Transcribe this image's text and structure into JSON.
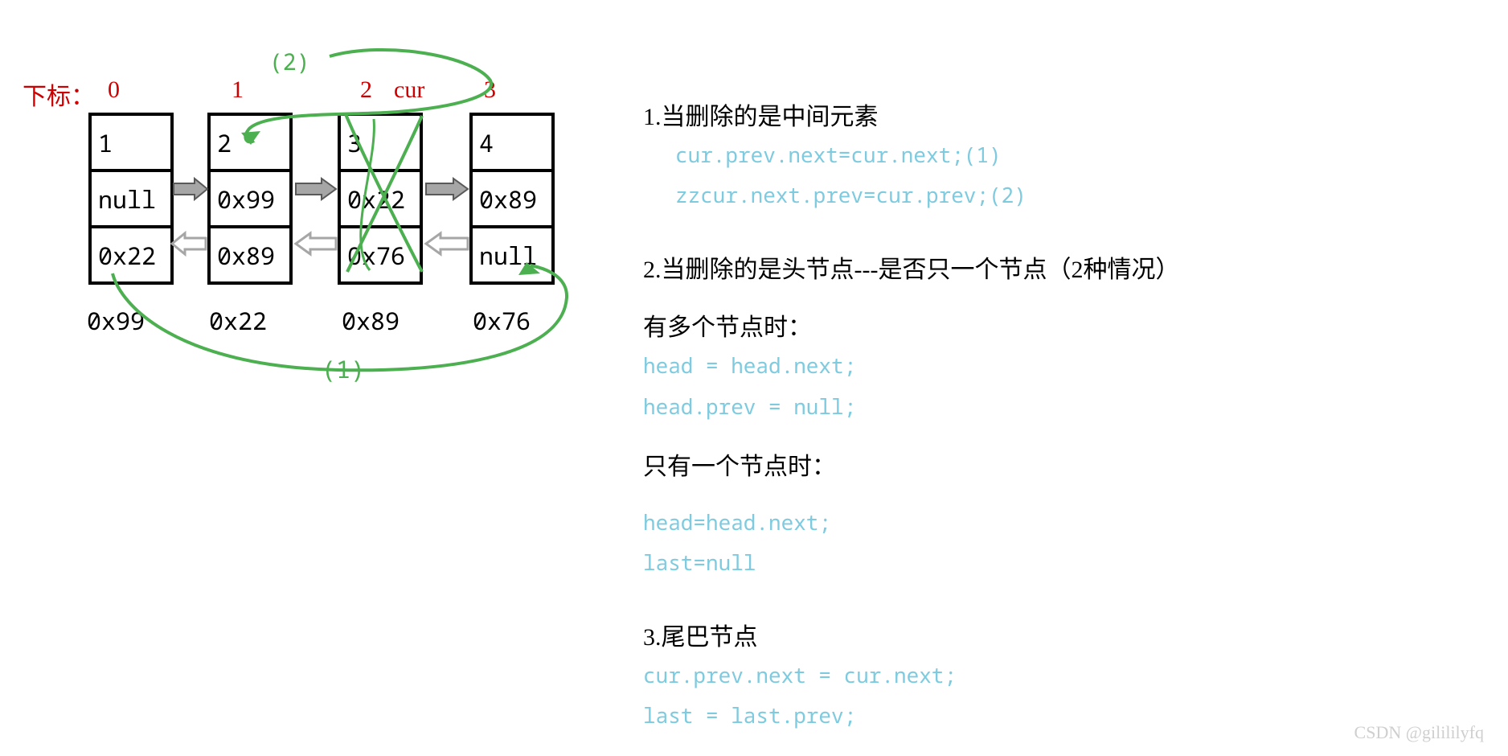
{
  "diagram": {
    "indexLabel": "下标：",
    "indices": [
      "0",
      "1",
      "2",
      "3"
    ],
    "curLabel": "cur",
    "nodes": [
      {
        "val": "1",
        "prev": "null",
        "next": "0x22",
        "addr": "0x99"
      },
      {
        "val": "2",
        "prev": "0x99",
        "next": "0x89",
        "addr": "0x22"
      },
      {
        "val": "3",
        "prev": "0x22",
        "next": "0x76",
        "addr": "0x89"
      },
      {
        "val": "4",
        "prev": "0x89",
        "next": "null",
        "addr": "0x76"
      }
    ],
    "annotations": {
      "one": "(1)",
      "two": "(2)"
    }
  },
  "sections": {
    "s1": {
      "title": "1.当删除的是中间元素",
      "code": [
        "cur.prev.next=cur.next;(1)",
        "zzcur.next.prev=cur.prev;(2)"
      ]
    },
    "s2": {
      "title": "2.当删除的是头节点---是否只一个节点（2种情况）",
      "sub1": "有多个节点时：",
      "code1": [
        "head = head.next;",
        "head.prev = null;"
      ],
      "sub2": "只有一个节点时：",
      "code2": [
        "head=head.next;",
        "last=null"
      ]
    },
    "s3": {
      "title": "3.尾巴节点",
      "code": [
        "cur.prev.next = cur.next;",
        "last = last.prev;"
      ]
    }
  },
  "watermark": "CSDN @gilililyfq"
}
